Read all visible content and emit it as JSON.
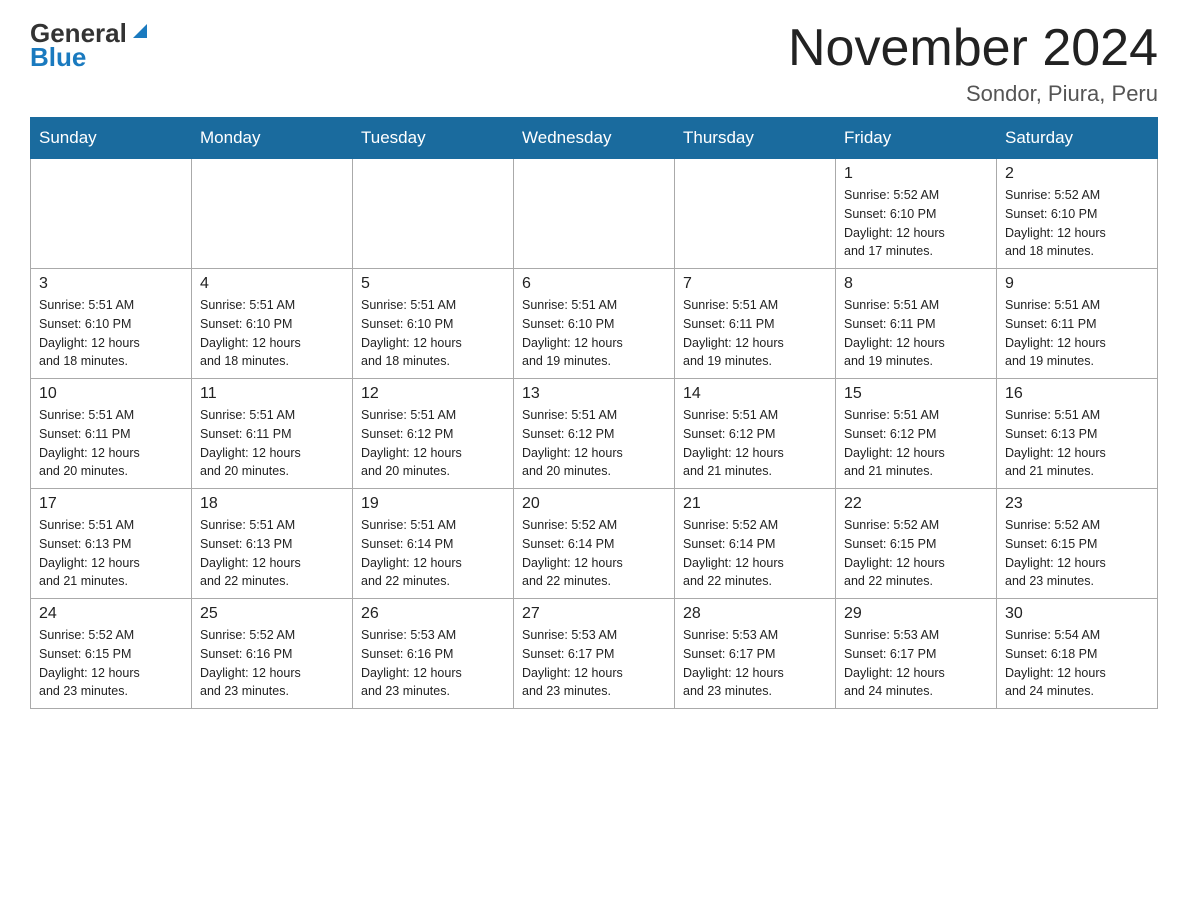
{
  "header": {
    "logo_general": "General",
    "logo_blue": "Blue",
    "month_title": "November 2024",
    "location": "Sondor, Piura, Peru"
  },
  "calendar": {
    "days_of_week": [
      "Sunday",
      "Monday",
      "Tuesday",
      "Wednesday",
      "Thursday",
      "Friday",
      "Saturday"
    ],
    "weeks": [
      [
        {
          "day": "",
          "info": ""
        },
        {
          "day": "",
          "info": ""
        },
        {
          "day": "",
          "info": ""
        },
        {
          "day": "",
          "info": ""
        },
        {
          "day": "",
          "info": ""
        },
        {
          "day": "1",
          "info": "Sunrise: 5:52 AM\nSunset: 6:10 PM\nDaylight: 12 hours\nand 17 minutes."
        },
        {
          "day": "2",
          "info": "Sunrise: 5:52 AM\nSunset: 6:10 PM\nDaylight: 12 hours\nand 18 minutes."
        }
      ],
      [
        {
          "day": "3",
          "info": "Sunrise: 5:51 AM\nSunset: 6:10 PM\nDaylight: 12 hours\nand 18 minutes."
        },
        {
          "day": "4",
          "info": "Sunrise: 5:51 AM\nSunset: 6:10 PM\nDaylight: 12 hours\nand 18 minutes."
        },
        {
          "day": "5",
          "info": "Sunrise: 5:51 AM\nSunset: 6:10 PM\nDaylight: 12 hours\nand 18 minutes."
        },
        {
          "day": "6",
          "info": "Sunrise: 5:51 AM\nSunset: 6:10 PM\nDaylight: 12 hours\nand 19 minutes."
        },
        {
          "day": "7",
          "info": "Sunrise: 5:51 AM\nSunset: 6:11 PM\nDaylight: 12 hours\nand 19 minutes."
        },
        {
          "day": "8",
          "info": "Sunrise: 5:51 AM\nSunset: 6:11 PM\nDaylight: 12 hours\nand 19 minutes."
        },
        {
          "day": "9",
          "info": "Sunrise: 5:51 AM\nSunset: 6:11 PM\nDaylight: 12 hours\nand 19 minutes."
        }
      ],
      [
        {
          "day": "10",
          "info": "Sunrise: 5:51 AM\nSunset: 6:11 PM\nDaylight: 12 hours\nand 20 minutes."
        },
        {
          "day": "11",
          "info": "Sunrise: 5:51 AM\nSunset: 6:11 PM\nDaylight: 12 hours\nand 20 minutes."
        },
        {
          "day": "12",
          "info": "Sunrise: 5:51 AM\nSunset: 6:12 PM\nDaylight: 12 hours\nand 20 minutes."
        },
        {
          "day": "13",
          "info": "Sunrise: 5:51 AM\nSunset: 6:12 PM\nDaylight: 12 hours\nand 20 minutes."
        },
        {
          "day": "14",
          "info": "Sunrise: 5:51 AM\nSunset: 6:12 PM\nDaylight: 12 hours\nand 21 minutes."
        },
        {
          "day": "15",
          "info": "Sunrise: 5:51 AM\nSunset: 6:12 PM\nDaylight: 12 hours\nand 21 minutes."
        },
        {
          "day": "16",
          "info": "Sunrise: 5:51 AM\nSunset: 6:13 PM\nDaylight: 12 hours\nand 21 minutes."
        }
      ],
      [
        {
          "day": "17",
          "info": "Sunrise: 5:51 AM\nSunset: 6:13 PM\nDaylight: 12 hours\nand 21 minutes."
        },
        {
          "day": "18",
          "info": "Sunrise: 5:51 AM\nSunset: 6:13 PM\nDaylight: 12 hours\nand 22 minutes."
        },
        {
          "day": "19",
          "info": "Sunrise: 5:51 AM\nSunset: 6:14 PM\nDaylight: 12 hours\nand 22 minutes."
        },
        {
          "day": "20",
          "info": "Sunrise: 5:52 AM\nSunset: 6:14 PM\nDaylight: 12 hours\nand 22 minutes."
        },
        {
          "day": "21",
          "info": "Sunrise: 5:52 AM\nSunset: 6:14 PM\nDaylight: 12 hours\nand 22 minutes."
        },
        {
          "day": "22",
          "info": "Sunrise: 5:52 AM\nSunset: 6:15 PM\nDaylight: 12 hours\nand 22 minutes."
        },
        {
          "day": "23",
          "info": "Sunrise: 5:52 AM\nSunset: 6:15 PM\nDaylight: 12 hours\nand 23 minutes."
        }
      ],
      [
        {
          "day": "24",
          "info": "Sunrise: 5:52 AM\nSunset: 6:15 PM\nDaylight: 12 hours\nand 23 minutes."
        },
        {
          "day": "25",
          "info": "Sunrise: 5:52 AM\nSunset: 6:16 PM\nDaylight: 12 hours\nand 23 minutes."
        },
        {
          "day": "26",
          "info": "Sunrise: 5:53 AM\nSunset: 6:16 PM\nDaylight: 12 hours\nand 23 minutes."
        },
        {
          "day": "27",
          "info": "Sunrise: 5:53 AM\nSunset: 6:17 PM\nDaylight: 12 hours\nand 23 minutes."
        },
        {
          "day": "28",
          "info": "Sunrise: 5:53 AM\nSunset: 6:17 PM\nDaylight: 12 hours\nand 23 minutes."
        },
        {
          "day": "29",
          "info": "Sunrise: 5:53 AM\nSunset: 6:17 PM\nDaylight: 12 hours\nand 24 minutes."
        },
        {
          "day": "30",
          "info": "Sunrise: 5:54 AM\nSunset: 6:18 PM\nDaylight: 12 hours\nand 24 minutes."
        }
      ]
    ]
  }
}
